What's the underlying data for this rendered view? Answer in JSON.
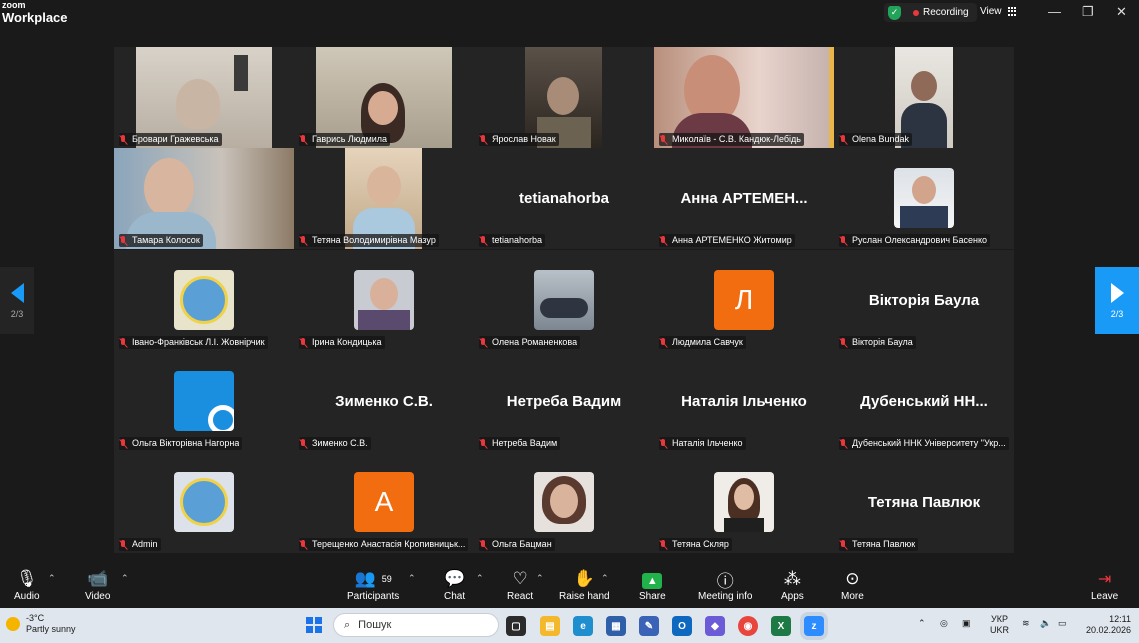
{
  "app": {
    "brand_top": "zoom",
    "brand_bottom": "Workplace"
  },
  "status": {
    "recording": "Recording",
    "view": "View"
  },
  "window_controls": {
    "minimize": "—",
    "restore": "❐",
    "close": "✕"
  },
  "page": {
    "left": "2/3",
    "right": "2/3"
  },
  "participants": [
    {
      "name": "Бровари Гражевська"
    },
    {
      "name": "Гаврись Людмила"
    },
    {
      "name": "Ярослав Новак"
    },
    {
      "name": "Миколаїв - С.В. Кандюк-Лебідь"
    },
    {
      "name": "Olena Bundak"
    },
    {
      "name": "Тамара Колосок"
    },
    {
      "name": "Тетяна Володимирівна Мазур"
    },
    {
      "name": "tetianahorba",
      "display": "tetianahorba"
    },
    {
      "name": "Анна АРТЕМЕНКО Житомир",
      "display": "Анна  АРТЕМЕН..."
    },
    {
      "name": "Руслан Олександрович Басенко"
    },
    {
      "name": "Івано-Франківськ Л.І. Жовнірчик"
    },
    {
      "name": "Ірина Кондицька"
    },
    {
      "name": "Олена Романенкова"
    },
    {
      "name": "Людмила Савчук",
      "letter": "Л"
    },
    {
      "name": "Вікторія Баула",
      "display": "Вікторія Баула"
    },
    {
      "name": "Ольга Вікторівна Нагорна"
    },
    {
      "name": "Зименко С.В.",
      "display": "Зименко С.В."
    },
    {
      "name": "Нетреба Вадим",
      "display": "Нетреба Вадим"
    },
    {
      "name": "Наталія Ільченко",
      "display": "Наталія Ільченко"
    },
    {
      "name": "Дубенський ННК Університету \"Укр...",
      "display": "Дубенський  НН..."
    },
    {
      "name": "Admin"
    },
    {
      "name": "Терещенко  Анастасія Кропивницьк...",
      "letter": "A"
    },
    {
      "name": "Ольга Бацман"
    },
    {
      "name": "Тетяна Скляр"
    },
    {
      "name": "Тетяна Павлюк",
      "display": "Тетяна Павлюк"
    }
  ],
  "toolbar": {
    "audio": "Audio",
    "video": "Video",
    "participants": "Participants",
    "participants_count": "59",
    "chat": "Chat",
    "react": "React",
    "raise_hand": "Raise hand",
    "share": "Share",
    "meeting_info": "Meeting info",
    "apps": "Apps",
    "more": "More",
    "leave": "Leave"
  },
  "taskbar": {
    "temp": "-3°C",
    "weather": "Partly sunny",
    "search_placeholder": "Пошук",
    "lang1": "УКР",
    "lang2": "UKR",
    "time": "12:11",
    "date": "20.02.2026"
  },
  "colors": {
    "accent": "#1a9af7",
    "orange_avatar": "#f26d0f",
    "mic_off": "#e8383d",
    "share": "#22b24c"
  }
}
